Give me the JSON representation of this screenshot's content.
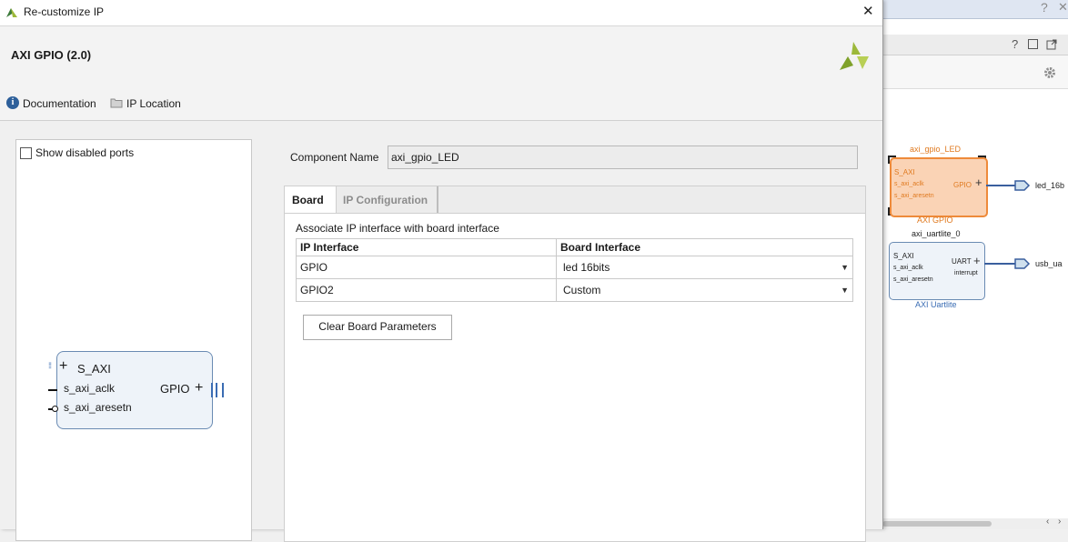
{
  "background_window": {
    "help_glyph": "?",
    "close_glyph": "✕",
    "panel_help_glyph": "?",
    "gpio_block": {
      "instance_name": "axi_gpio_LED",
      "ports": [
        "S_AXI",
        "s_axi_aclk",
        "s_axi_aresetn"
      ],
      "output_port": "GPIO",
      "type_label": "AXI GPIO",
      "net_label": "led_16b"
    },
    "uart_block": {
      "instance_name": "axi_uartlite_0",
      "ports": [
        "S_AXI",
        "s_axi_aclk",
        "s_axi_aresetn"
      ],
      "output_port": "UART",
      "output_port2": "interrupt",
      "type_label": "AXI Uartlite",
      "net_label": "usb_ua"
    }
  },
  "dialog": {
    "title": "Re-customize IP",
    "close_glyph": "✕",
    "ip_name": "AXI GPIO (2.0)",
    "links": {
      "documentation": "Documentation",
      "ip_location": "IP Location"
    },
    "show_disabled_ports": {
      "label": "Show disabled ports",
      "checked": false
    },
    "symbol": {
      "ports": [
        "S_AXI",
        "s_axi_aclk",
        "s_axi_aresetn"
      ],
      "output_port": "GPIO"
    },
    "component_name": {
      "label": "Component Name",
      "value": "axi_gpio_LED"
    },
    "tabs": [
      {
        "label": "Board",
        "active": true
      },
      {
        "label": "IP Configuration",
        "active": false
      }
    ],
    "board": {
      "caption": "Associate IP interface with board interface",
      "headers": [
        "IP Interface",
        "Board Interface"
      ],
      "rows": [
        {
          "ip_interface": "GPIO",
          "board_interface": "led 16bits"
        },
        {
          "ip_interface": "GPIO2",
          "board_interface": "Custom"
        }
      ],
      "clear_button": "Clear Board Parameters"
    }
  },
  "colors": {
    "accent_orange": "#f0a060",
    "block_blue": "#6a8bb3",
    "logo_green": "#9cb83a"
  }
}
